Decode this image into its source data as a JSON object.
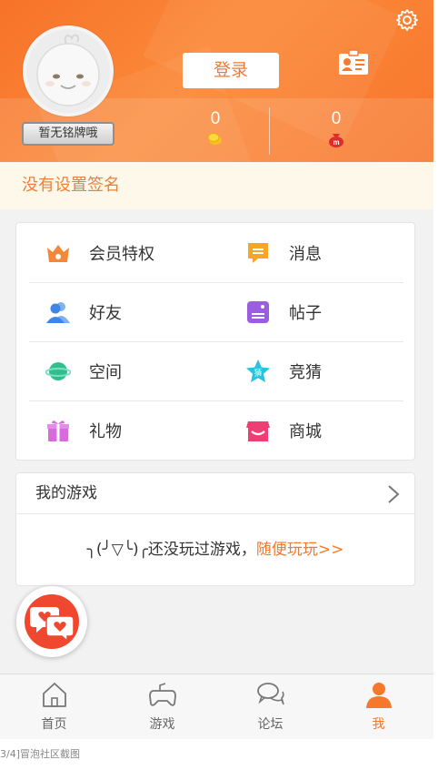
{
  "header": {
    "badge_text": "暂无铭牌哦",
    "login_label": "登录",
    "stats": [
      {
        "value": "0",
        "icon": "coin-icon"
      },
      {
        "value": "0",
        "icon": "money-bag-icon"
      }
    ],
    "settings_icon": "gear-icon",
    "card_icon": "id-card-icon"
  },
  "signature": {
    "text": "没有设置签名"
  },
  "menu": {
    "items": [
      {
        "label": "会员特权",
        "icon": "crown-icon",
        "color": "#f5873a"
      },
      {
        "label": "消息",
        "icon": "message-icon",
        "color": "#f6a623"
      },
      {
        "label": "好友",
        "icon": "friends-icon",
        "color": "#3d86e8"
      },
      {
        "label": "帖子",
        "icon": "post-icon",
        "color": "#9b5ee0"
      },
      {
        "label": "空间",
        "icon": "planet-icon",
        "color": "#2fbf8f"
      },
      {
        "label": "竞猜",
        "icon": "guess-star-icon",
        "color": "#27c3e0",
        "icon_text": "猜"
      },
      {
        "label": "礼物",
        "icon": "gift-icon",
        "color": "#d76bdc"
      },
      {
        "label": "商城",
        "icon": "shop-icon",
        "color": "#ee3f74"
      }
    ]
  },
  "games": {
    "title": "我的游戏",
    "empty_text": "╮(╯▽╰)╭还没玩过游戏，",
    "link_text": "随便玩玩>>"
  },
  "tabs": [
    {
      "label": "首页",
      "icon": "home-icon",
      "active": false
    },
    {
      "label": "游戏",
      "icon": "gamepad-icon",
      "active": false
    },
    {
      "label": "论坛",
      "icon": "chat-bubbles-icon",
      "active": false
    },
    {
      "label": "我",
      "icon": "person-icon",
      "active": true
    }
  ],
  "caption": "3/4]冒泡社区截图",
  "colors": {
    "accent": "#f5782c",
    "header": "#f8792d",
    "signature_bg": "#fdf8ea"
  }
}
